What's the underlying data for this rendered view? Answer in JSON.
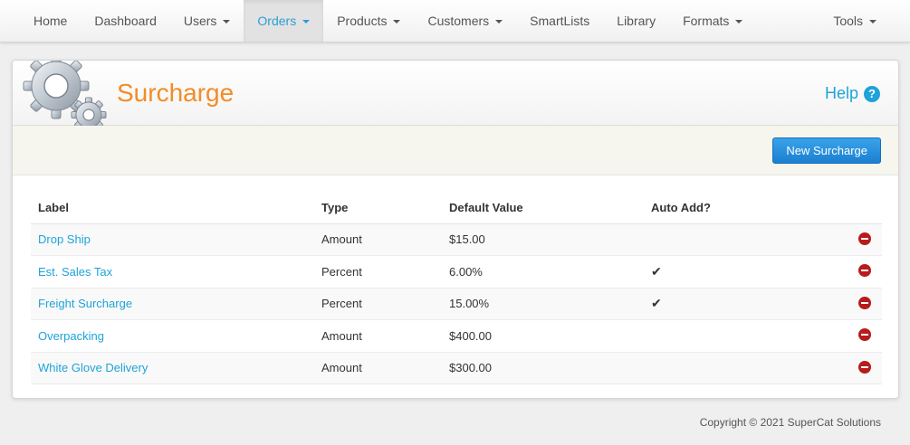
{
  "nav": {
    "left": [
      {
        "label": "Home",
        "dropdown": false,
        "active": false
      },
      {
        "label": "Dashboard",
        "dropdown": false,
        "active": false
      },
      {
        "label": "Users",
        "dropdown": true,
        "active": false
      },
      {
        "label": "Orders",
        "dropdown": true,
        "active": true
      },
      {
        "label": "Products",
        "dropdown": true,
        "active": false
      },
      {
        "label": "Customers",
        "dropdown": true,
        "active": false
      },
      {
        "label": "SmartLists",
        "dropdown": false,
        "active": false
      },
      {
        "label": "Library",
        "dropdown": false,
        "active": false
      },
      {
        "label": "Formats",
        "dropdown": true,
        "active": false
      }
    ],
    "right": [
      {
        "label": "Tools",
        "dropdown": true,
        "active": false
      }
    ]
  },
  "header": {
    "title": "Surcharge",
    "help_label": "Help",
    "help_icon": "?"
  },
  "toolbar": {
    "new_button_label": "New Surcharge"
  },
  "table": {
    "columns": [
      "Label",
      "Type",
      "Default Value",
      "Auto Add?",
      ""
    ],
    "rows": [
      {
        "label": "Drop Ship",
        "type": "Amount",
        "default_value": "$15.00",
        "auto_add": ""
      },
      {
        "label": "Est. Sales Tax",
        "type": "Percent",
        "default_value": "6.00%",
        "auto_add": "✔"
      },
      {
        "label": "Freight Surcharge",
        "type": "Percent",
        "default_value": "15.00%",
        "auto_add": "✔"
      },
      {
        "label": "Overpacking",
        "type": "Amount",
        "default_value": "$400.00",
        "auto_add": ""
      },
      {
        "label": "White Glove Delivery",
        "type": "Amount",
        "default_value": "$300.00",
        "auto_add": ""
      }
    ]
  },
  "footer": {
    "copyright": "Copyright © 2021 SuperCat Solutions"
  },
  "colors": {
    "accent": "#2a9fd6",
    "title": "#f28c28",
    "button": "#1a7fd1",
    "delete": "#b71c1c"
  }
}
